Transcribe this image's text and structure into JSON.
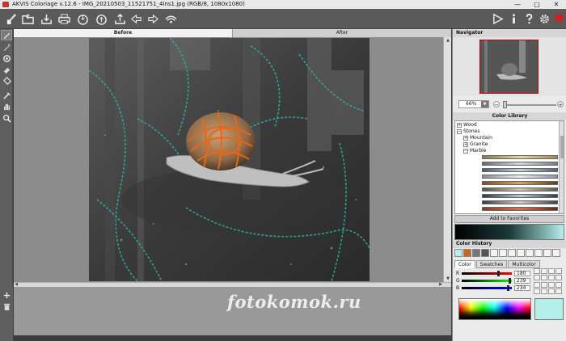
{
  "window": {
    "title": "AKVIS Coloriage v.12.6 - IMG_20210503_11521751_4ins1.jpg (RGB/8, 1080x1080)",
    "minimize": "—",
    "maximize": "□",
    "close": "✕"
  },
  "toolbar": {
    "icons": [
      "brush-icon",
      "open-file-icon",
      "save-icon",
      "print-icon",
      "load-strokes-icon",
      "save-strokes-icon",
      "upload-icon",
      "undo-icon",
      "redo-icon",
      "reset-icon",
      "run-icon",
      "info-icon",
      "help-icon",
      "settings-icon",
      "news-icon"
    ]
  },
  "tabs": {
    "before": "Before",
    "after": "After"
  },
  "watermark": "fotokomok.ru",
  "navigator": {
    "title": "Navigator",
    "zoom": "66%"
  },
  "color_library": {
    "title": "Color Library",
    "items": [
      {
        "label": "Wood",
        "expanded": false
      },
      {
        "label": "Stones",
        "expanded": true
      },
      {
        "label": "Mountain",
        "expanded": false
      },
      {
        "label": "Granite",
        "expanded": false
      },
      {
        "label": "Marble",
        "expanded": true
      }
    ],
    "add_favorites": "Add to Favorites"
  },
  "color_history": {
    "title": "Color History",
    "colors": [
      "#b4efea",
      "#c8641c",
      "#777777",
      "#555555"
    ]
  },
  "color_tabs": {
    "color": "Color",
    "swatches": "Swatches",
    "multicolor": "Multicolor"
  },
  "rgb": {
    "r_label": "R",
    "r": "180",
    "g_label": "G",
    "g": "239",
    "b_label": "B",
    "b": "234"
  },
  "current_color": "#b4efea"
}
